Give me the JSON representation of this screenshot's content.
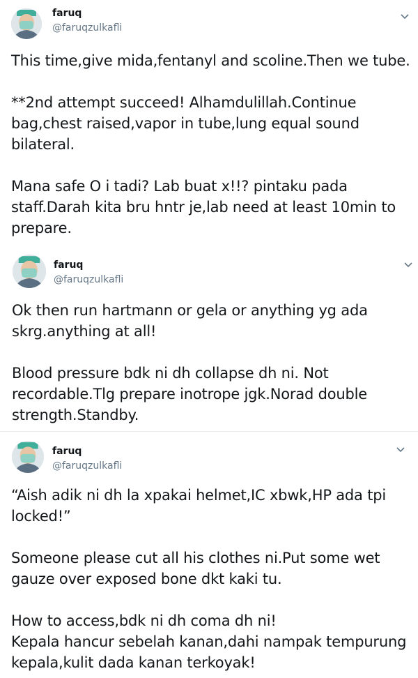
{
  "colors": {
    "text": "#14171a",
    "secondary": "#657786",
    "divider": "#e6ecf0",
    "thread_line": "#ccd6dd"
  },
  "tweets": [
    {
      "name": "faruq",
      "handle": "@faruqzulkafli",
      "menu_icon": "chevron-down-icon",
      "text": "This time,give mida,fentanyl and scoline.Then we tube.\n\n**2nd attempt succeed! Alhamdulillah.Continue\nbag,chest raised,vapor in tube,lung equal sound\nbilateral.\n\nMana safe O i tadi? Lab buat x!!? pintaku pada\nstaff.Darah kita bru hntr je,lab need at least 10min to\nprepare."
    },
    {
      "name": "faruq",
      "handle": "@faruqzulkafli",
      "menu_icon": "chevron-down-icon",
      "text": "Ok then run hartmann or gela or anything yg ada\nskrg.anything at all!\n\nBlood pressure bdk ni dh collapse dh ni. Not\nrecordable.Tlg prepare inotrope jgk.Norad double\nstrength.Standby."
    },
    {
      "name": "faruq",
      "handle": "@faruqzulkafli",
      "menu_icon": "chevron-down-icon",
      "text": "“Aish adik ni dh la xpakai helmet,IC xbwk,HP ada tpi\nlocked!”\n\nSomeone please cut all his clothes ni.Put some wet\ngauze over exposed bone dkt kaki tu.\n\nHow to access,bdk ni dh coma dh ni!\nKepala hancur sebelah kanan,dahi nampak tempurung\nkepala,kulit dada kanan terkoyak!"
    }
  ]
}
